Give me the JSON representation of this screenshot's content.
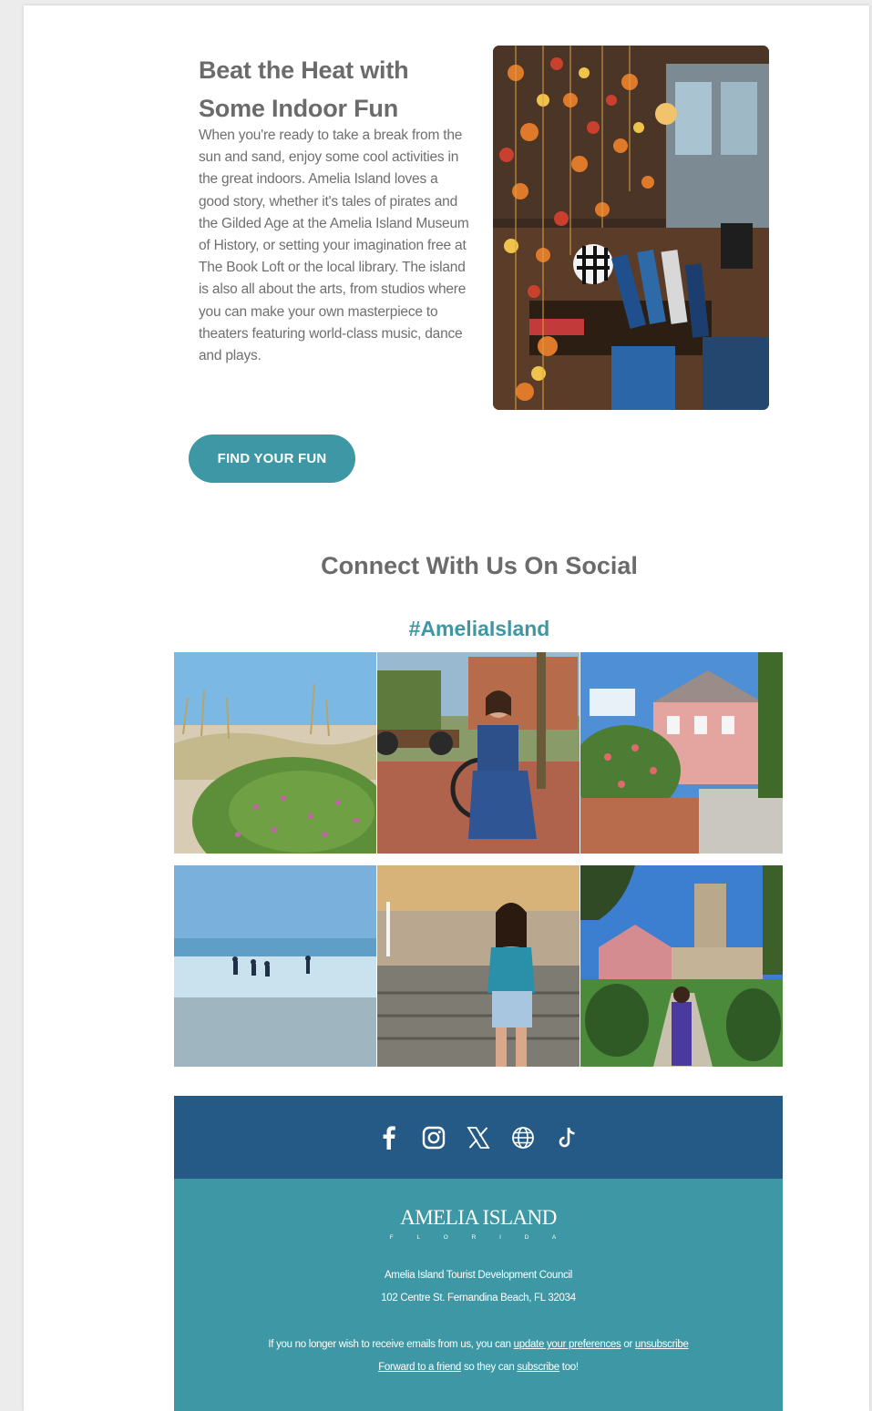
{
  "feature": {
    "title": "Beat the Heat with Some Indoor Fun",
    "body": "When you're ready to take a break from the sun and sand, enjoy some cool activities in the great indoors. Amelia Island loves a good story, whether it's tales of pirates and the Gilded Age at the Amelia Island Museum of History, or setting your imagination free at The Book Loft or the local library. The island is also all about the arts, from studios where you can make your own masterpiece to theaters featuring world-class music, dance and plays.",
    "cta_label": "FIND YOUR FUN"
  },
  "social": {
    "title": "Connect With Us On Social",
    "hashtag": "#AmeliaIsland",
    "icons": [
      "facebook-icon",
      "instagram-icon",
      "x-icon",
      "globe-icon",
      "tiktok-icon"
    ]
  },
  "footer": {
    "logo_text": "AMELIA ISLAND",
    "logo_sub": "F L O R I D A",
    "org": "Amelia Island Tourist Development Council",
    "address": "102 Centre St. Fernandina Beach, FL 32034",
    "unsub_prefix": "If you no longer wish to receive emails from us, you can",
    "update_prefs": "update your preferences",
    "or_text": "or",
    "unsubscribe": "unsubscribe",
    "forward": "Forward to a friend",
    "so_they_can": "so they can",
    "subscribe": "subscribe",
    "too": "too!"
  },
  "colors": {
    "teal": "#3d97a4",
    "navy": "#255a86",
    "heading_gray": "#6b6b6b"
  }
}
